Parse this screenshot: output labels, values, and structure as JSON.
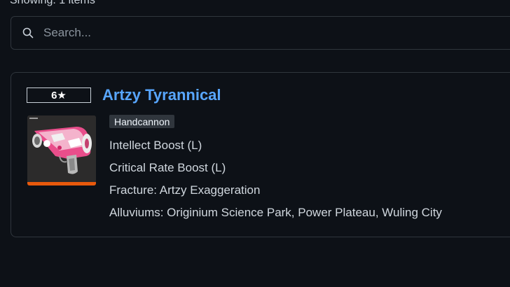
{
  "header": {
    "showing_text": "Showing: 1 items"
  },
  "search": {
    "placeholder": "Search..."
  },
  "item": {
    "rarity": "6★",
    "name": "Artzy Tyrannical",
    "type": "Handcannon",
    "stats": [
      "Intellect Boost (L)",
      "Critical Rate Boost (L)",
      "Fracture: Artzy Exaggeration",
      "Alluviums: Originium Science Park, Power Plateau, Wuling City"
    ],
    "rarity_color": "#e8590c",
    "name_color": "#58a6ff"
  }
}
